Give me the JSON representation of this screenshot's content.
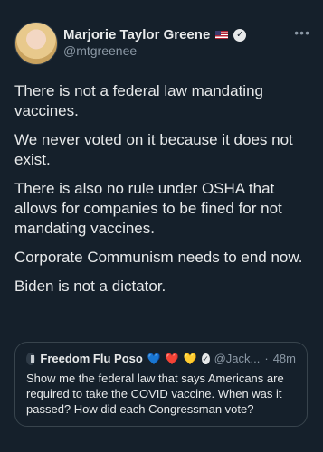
{
  "author": {
    "name": "Marjorie Taylor Greene",
    "handle": "@mtgreenee",
    "icons": [
      "flag-icon",
      "verified-icon",
      "more-icon"
    ]
  },
  "tweet": {
    "paragraphs": [
      "There is not a federal law mandating vaccines.",
      "We never voted on it because it does not exist.",
      "There is also no rule under OSHA that allows for companies to be fined for not mandating vaccines.",
      "Corporate Communism needs to end now.",
      "Biden is not a dictator."
    ]
  },
  "quote": {
    "name": "Freedom Flu Poso",
    "handle": "@Jack...",
    "separator": "·",
    "time": "48m",
    "hearts": [
      "💙",
      "❤️",
      "💛"
    ],
    "text": "Show me the federal law that says Americans are required to take the COVID vaccine. When was it passed? How did each Congressman vote?"
  },
  "colors": {
    "background": "#15202b",
    "text": "#e7e9ea",
    "secondary": "#8b98a5",
    "border": "#38444d"
  }
}
